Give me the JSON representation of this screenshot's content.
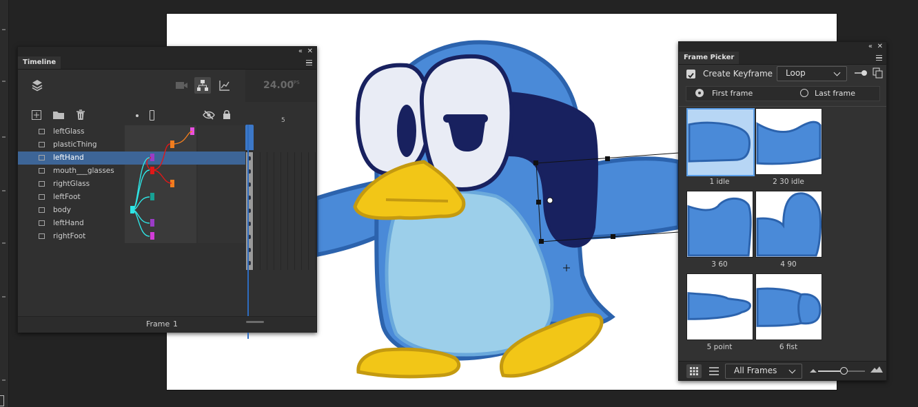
{
  "timeline": {
    "title": "Timeline",
    "fps": "24.00",
    "fps_unit": "FPS",
    "ruler_label": "5",
    "frame_label": "Frame",
    "frame_value": "1",
    "layers": [
      {
        "name": "leftGlass",
        "selected": false
      },
      {
        "name": "plasticThing",
        "selected": false
      },
      {
        "name": "leftHand",
        "selected": true
      },
      {
        "name": "mouth___glasses",
        "selected": false
      },
      {
        "name": "rightGlass",
        "selected": false
      },
      {
        "name": "leftFoot",
        "selected": false
      },
      {
        "name": "body",
        "selected": false
      },
      {
        "name": "leftHand",
        "selected": false
      },
      {
        "name": "rightFoot",
        "selected": false
      }
    ],
    "pin_colors": [
      "#e84fe0",
      "#f07d1e",
      "#9b3cc6",
      "#e01818",
      "#f07d1e",
      "#17a094",
      "#2ee6e6",
      "#9b3cc6",
      "#d23cd8"
    ]
  },
  "picker": {
    "title": "Frame Picker",
    "create_keyframe": "Create Keyframe",
    "create_keyframe_checked": true,
    "loop_value": "Loop",
    "first_frame": "First frame",
    "last_frame": "Last frame",
    "frames": [
      {
        "label": "1 idle",
        "selected": true,
        "shape": "idle"
      },
      {
        "label": "2 30 idle",
        "selected": false,
        "shape": "idle2"
      },
      {
        "label": "3 60",
        "selected": false,
        "shape": "heart"
      },
      {
        "label": "4 90",
        "selected": false,
        "shape": "heart2"
      },
      {
        "label": "5 point",
        "selected": false,
        "shape": "point"
      },
      {
        "label": "6 fist",
        "selected": false,
        "shape": "fist"
      }
    ],
    "filter_value": "All Frames"
  },
  "colors": {
    "penguin_blue": "#4a8ad8",
    "penguin_outline": "#2c63ad",
    "navy": "#18215f",
    "belly": "#9ccfea",
    "beak": "#f2c617",
    "beak_outline": "#c49a10",
    "selection_blue": "#3d6597",
    "accent": "#3c78c8"
  }
}
